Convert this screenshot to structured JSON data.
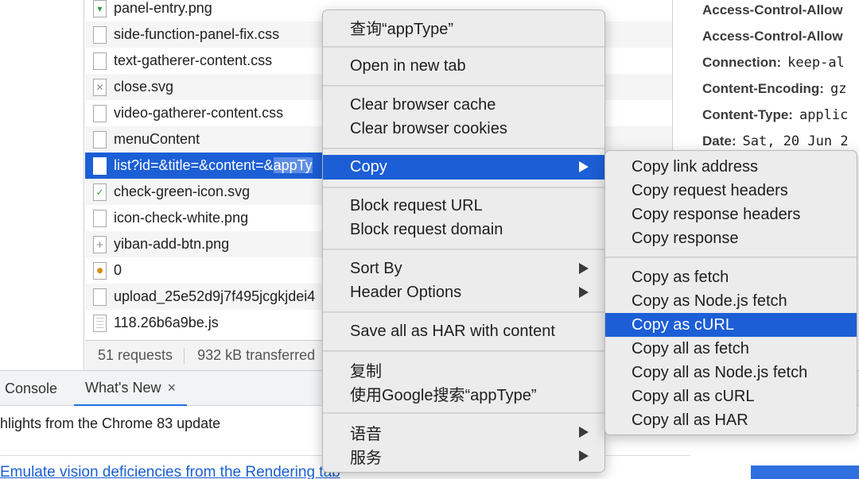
{
  "network": {
    "requests": [
      {
        "name": "panel-entry.png",
        "icon": "image-file-icon"
      },
      {
        "name": "side-function-panel-fix.css",
        "icon": "file-icon"
      },
      {
        "name": "text-gatherer-content.css",
        "icon": "file-icon"
      },
      {
        "name": "close.svg",
        "icon": "svg-file-icon"
      },
      {
        "name": "video-gatherer-content.css",
        "icon": "file-icon"
      },
      {
        "name": "menuContent",
        "icon": "file-icon"
      },
      {
        "name_before": "list?id=&title=&content=&",
        "name_highlight": "appTy",
        "icon": "file-icon"
      },
      {
        "name": "check-green-icon.svg",
        "icon": "check-icon"
      },
      {
        "name": "icon-check-white.png",
        "icon": "file-icon"
      },
      {
        "name": "yiban-add-btn.png",
        "icon": "plus-file-icon"
      },
      {
        "name": "0",
        "icon": "image-file-icon"
      },
      {
        "name": "upload_25e52d9j7f495jcgkjdei4",
        "icon": "file-icon"
      },
      {
        "name": "118.26b6a9be.js",
        "icon": "script-file-icon"
      }
    ],
    "footer": {
      "requests": "51 requests",
      "transferred": "932 kB transferred"
    }
  },
  "headers": [
    {
      "key": "Access-Control-Allow",
      "value": ""
    },
    {
      "key": "Access-Control-Allow",
      "value": ""
    },
    {
      "key": "Connection:",
      "value": "keep-al"
    },
    {
      "key": "Content-Encoding:",
      "value": "gz"
    },
    {
      "key": "Content-Type:",
      "value": "applic"
    },
    {
      "key": "Date:",
      "value": "Sat, 20 Jun 2"
    }
  ],
  "drawer": {
    "tabs": {
      "console": "Console",
      "whats_new": "What's New",
      "close": "×"
    },
    "heading": "hlights from the Chrome 83 update",
    "link": "Emulate vision deficiencies from the Rendering tab"
  },
  "context_menu": {
    "lookup": "查询“appType”",
    "open_new_tab": "Open in new tab",
    "clear_cache": "Clear browser cache",
    "clear_cookies": "Clear browser cookies",
    "copy": "Copy",
    "block_url": "Block request URL",
    "block_domain": "Block request domain",
    "sort_by": "Sort By",
    "header_options": "Header Options",
    "save_har": "Save all as HAR with content",
    "copy_cn": "复制",
    "google_search": "使用Google搜索“appType”",
    "speech": "语音",
    "services": "服务"
  },
  "copy_submenu": {
    "copy_link": "Copy link address",
    "copy_request_headers": "Copy request headers",
    "copy_response_headers": "Copy response headers",
    "copy_response": "Copy response",
    "copy_fetch": "Copy as fetch",
    "copy_node_fetch": "Copy as Node.js fetch",
    "copy_curl": "Copy as cURL",
    "copy_all_fetch": "Copy all as fetch",
    "copy_all_node_fetch": "Copy all as Node.js fetch",
    "copy_all_curl": "Copy all as cURL",
    "copy_all_har": "Copy all as HAR"
  },
  "colors": {
    "selection": "#1c5ed6",
    "menu_bg": "#ececec",
    "link": "#1a5fd1"
  }
}
